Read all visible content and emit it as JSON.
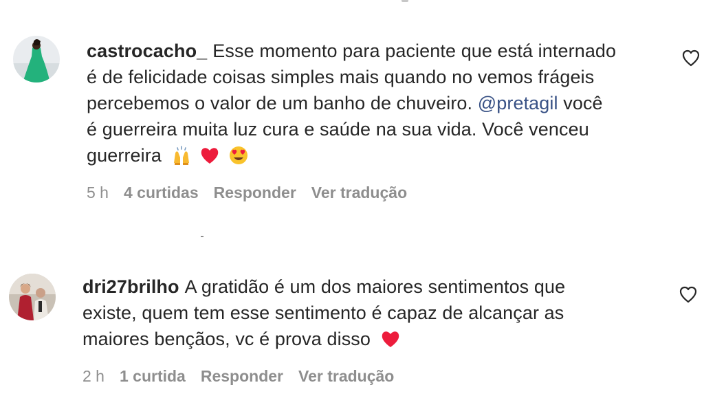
{
  "comments": [
    {
      "username": "castrocacho_",
      "line1": "Esse momento para paciente que está internado",
      "line2": "é de felicidade coisas simples mais quando no vemos frágeis",
      "line3_before": "percebemos o valor de um banho de chuveiro. ",
      "mention": "@pretagil",
      "line3_after": " você",
      "line4": "é guerreira muita luz cura e saúde na sua vida. Você venceu",
      "line5": "guerreira",
      "emojis": [
        "praising-hands-emoji",
        "red-heart-emoji",
        "heart-eyes-emoji"
      ],
      "time": "5 h",
      "likes": "4 curtidas",
      "reply": "Responder",
      "translate": "Ver tradução"
    },
    {
      "username": "dri27brilho",
      "line1": "A gratidão é um dos maiores sentimentos que",
      "line2": "existe, quem tem esse sentimento é capaz de alcançar as",
      "line3": "maiores bençãos, vc é prova disso",
      "emojis": [
        "red-heart-emoji"
      ],
      "time": "2 h",
      "likes": "1 curtida",
      "reply": "Responder",
      "translate": "Ver tradução"
    }
  ],
  "icons": {
    "like": "heart-outline-icon"
  },
  "colors": {
    "text": "#262626",
    "secondary": "#8e8e8e",
    "mention": "#385185",
    "heart": "#ed1c3c"
  }
}
